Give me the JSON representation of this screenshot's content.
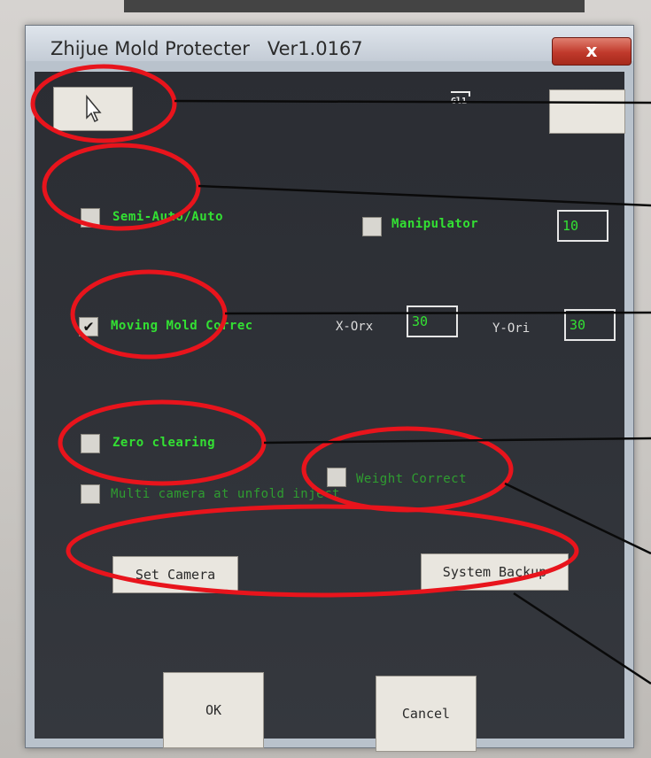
{
  "window": {
    "title": "Zhijue Mold Protecter   Ver1.0167",
    "close_label": "x"
  },
  "top_indicator": "Gl1",
  "options": {
    "semi_auto": {
      "label": "Semi-Auto/Auto",
      "checked": false
    },
    "manipulator": {
      "label": "Manipulator",
      "checked": false,
      "value": "10"
    },
    "moving_mold": {
      "label": "Moving Mold Correc",
      "checked": true
    },
    "x_orx": {
      "label": "X-Orx",
      "value": "30"
    },
    "y_ori": {
      "label": "Y-Ori",
      "value": "30"
    },
    "zero_clearing": {
      "label": "Zero clearing",
      "checked": false
    },
    "weight_correct": {
      "label": "Weight Correct",
      "checked": false
    },
    "multi_camera": {
      "label": "Multi camera at unfold inject",
      "checked": false
    }
  },
  "buttons": {
    "set_camera": "Set Camera",
    "system_backup": "System Backup",
    "ok": "OK",
    "cancel": "Cancel"
  },
  "annotation_color": "#e8141c"
}
